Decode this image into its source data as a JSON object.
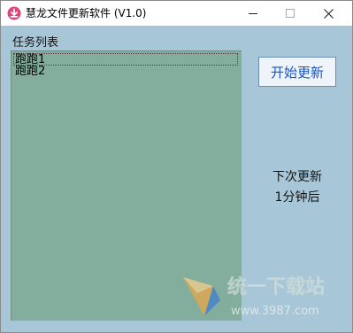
{
  "window": {
    "title": "慧龙文件更新软件 (V1.0)"
  },
  "titlebar_buttons": {
    "minimize": "—",
    "maximize": "☐",
    "close": "✕"
  },
  "task_list": {
    "label": "任务列表",
    "items": [
      "跑跑1",
      "跑跑2"
    ]
  },
  "start_button": {
    "label": "开始更新"
  },
  "next_update": {
    "line1": "下次更新",
    "line2": "1分钟后"
  },
  "watermark": {
    "brand": "统一下载站",
    "url": "www.3987.com"
  },
  "colors": {
    "client_bg": "#a7c7d9",
    "list_bg": "#83ae9d",
    "button_text": "#1a55c8"
  }
}
